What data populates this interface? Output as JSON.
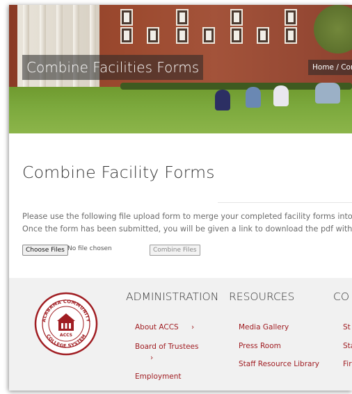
{
  "hero": {
    "title": "Combine Facilities Forms",
    "breadcrumb": "Home / Com"
  },
  "main": {
    "heading": "Combine Facility Forms",
    "paragraph_1": "Please use the following file upload form to merge your completed facility forms into one",
    "paragraph_2": "Once the form has been submitted, you will be given a link to download the pdf with your"
  },
  "form": {
    "choose_files_label": "Choose Files",
    "no_file_text": "No file chosen",
    "submit_label": "Combine Files"
  },
  "footer": {
    "seal": {
      "top_text": "ALABAMA COMMUNITY",
      "bottom_text": "COLLEGE SYSTEM",
      "center_text": "ACCS"
    },
    "administration": {
      "heading": "ADMINISTRATION",
      "links": [
        "About ACCS",
        "Board of Trustees",
        "Employment"
      ]
    },
    "resources": {
      "heading": "RESOURCES",
      "links": [
        "Media Gallery",
        "Press Room",
        "Staff Resource Library"
      ]
    },
    "third": {
      "heading": "CO",
      "links": [
        "St",
        "Sta",
        "Fir"
      ]
    },
    "chevron": "›"
  },
  "colors": {
    "brand_red": "#a01d22",
    "footer_bg": "#f1f1f1"
  }
}
